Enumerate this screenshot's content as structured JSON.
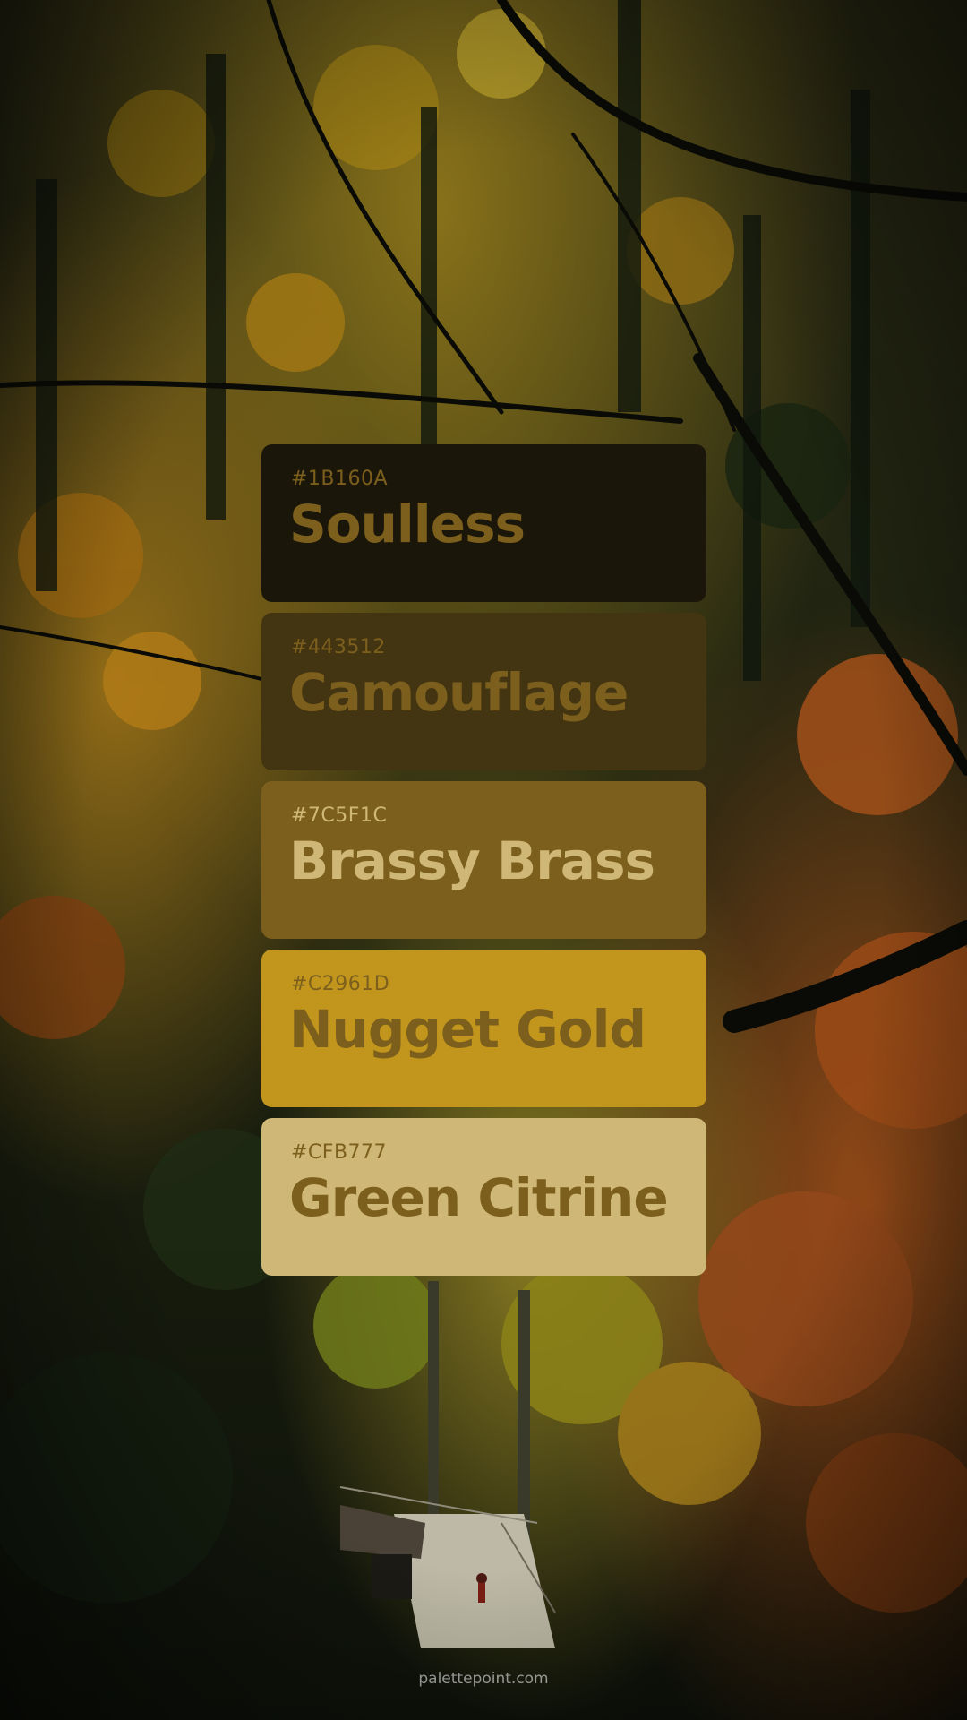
{
  "swatches": [
    {
      "hex": "#1B160A",
      "name": "Soulless",
      "bg": "#1B160A",
      "text": "#7C5F1C"
    },
    {
      "hex": "#443512",
      "name": "Camouflage",
      "bg": "#443512",
      "text": "#7C5F1C"
    },
    {
      "hex": "#7C5F1C",
      "name": "Brassy Brass",
      "bg": "#7C5F1C",
      "text": "#CFB777"
    },
    {
      "hex": "#C2961D",
      "name": "Nugget Gold",
      "bg": "#C2961D",
      "text": "#7C5F1C"
    },
    {
      "hex": "#CFB777",
      "name": "Green Citrine",
      "bg": "#CFB777",
      "text": "#7C5F1C"
    }
  ],
  "footer": {
    "text": "palettepoint.com"
  }
}
